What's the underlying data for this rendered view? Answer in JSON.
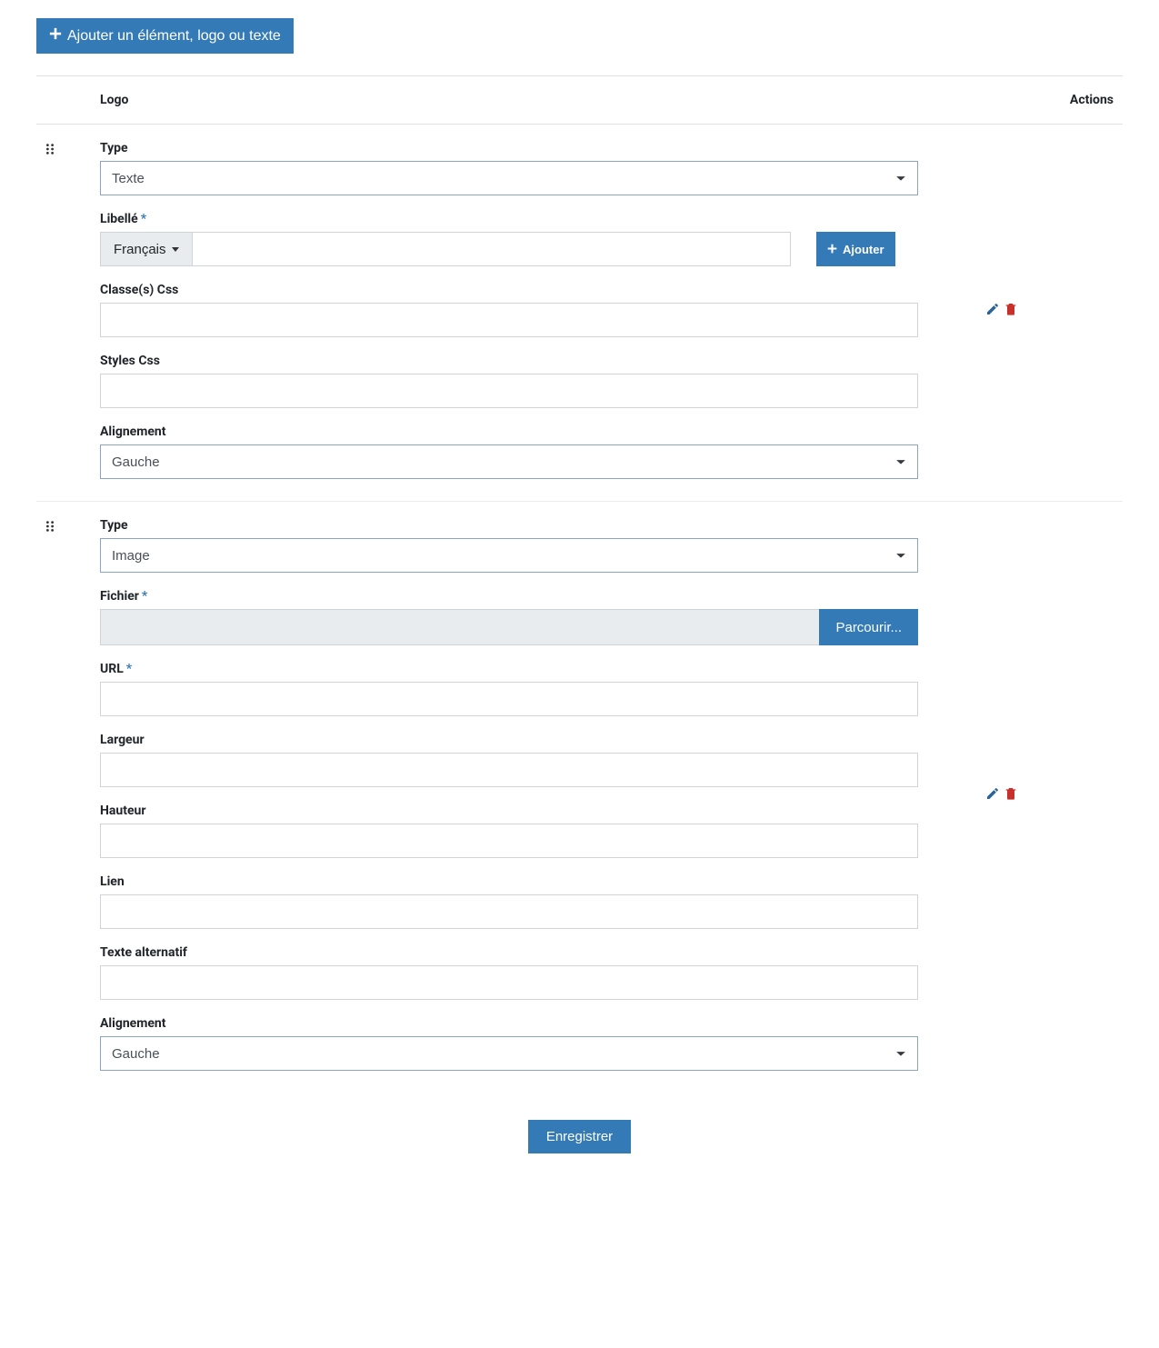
{
  "header": {
    "add_button_label": "Ajouter un élément, logo ou texte"
  },
  "table": {
    "col_logo": "Logo",
    "col_actions": "Actions"
  },
  "labels": {
    "type": "Type",
    "libelle": "Libellé",
    "css_classes": "Classe(s) Css",
    "css_styles": "Styles Css",
    "alignment": "Alignement",
    "fichier": "Fichier",
    "url": "URL",
    "largeur": "Largeur",
    "hauteur": "Hauteur",
    "lien": "Lien",
    "alt_text": "Texte alternatif",
    "language": "Français",
    "add": "Ajouter",
    "browse": "Parcourir...",
    "save": "Enregistrer"
  },
  "rows": [
    {
      "type_value": "Texte",
      "libelle_value": "",
      "css_classes_value": "",
      "css_styles_value": "",
      "alignment_value": "Gauche"
    },
    {
      "type_value": "Image",
      "fichier_value": "",
      "url_value": "",
      "largeur_value": "",
      "hauteur_value": "",
      "lien_value": "",
      "alt_text_value": "",
      "alignment_value": "Gauche"
    }
  ]
}
